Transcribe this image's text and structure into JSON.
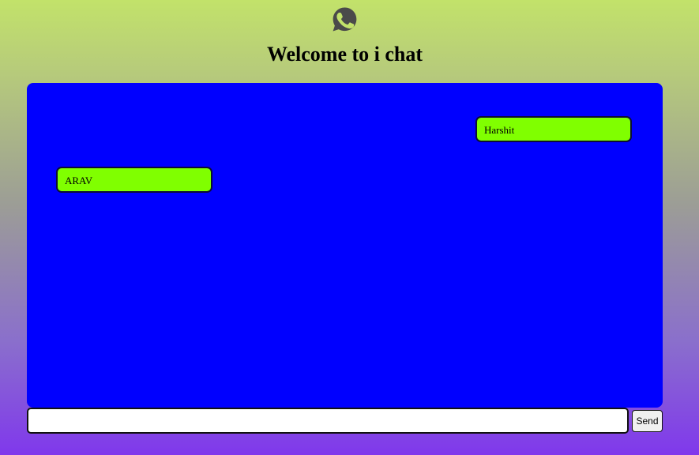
{
  "header": {
    "logo_icon": "whatsapp-icon",
    "title": "Welcome to i chat"
  },
  "chat": {
    "background_color": "#0000ff",
    "bubble_color": "#80ff00",
    "messages": [
      {
        "side": "right",
        "text": "Harshit"
      },
      {
        "side": "left",
        "text": "ARAV"
      }
    ]
  },
  "composer": {
    "input_value": "",
    "send_label": "Send"
  }
}
